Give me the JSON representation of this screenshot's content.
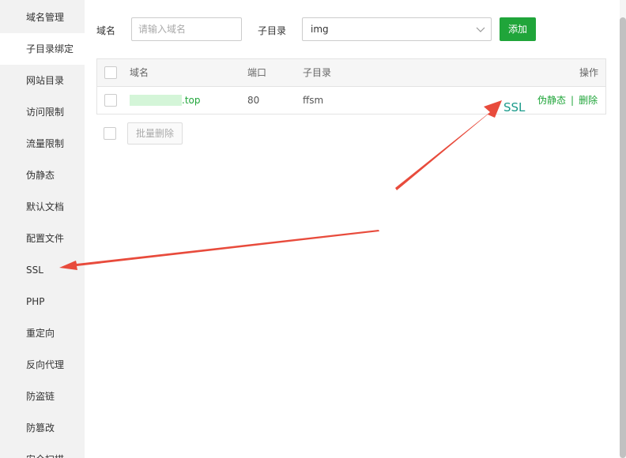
{
  "sidebar": {
    "items": [
      {
        "label": "域名管理"
      },
      {
        "label": "子目录绑定"
      },
      {
        "label": "网站目录"
      },
      {
        "label": "访问限制"
      },
      {
        "label": "流量限制"
      },
      {
        "label": "伪静态"
      },
      {
        "label": "默认文档"
      },
      {
        "label": "配置文件"
      },
      {
        "label": "SSL"
      },
      {
        "label": "PHP"
      },
      {
        "label": "重定向"
      },
      {
        "label": "反向代理"
      },
      {
        "label": "防盗链"
      },
      {
        "label": "防篡改"
      },
      {
        "label": "安全扫描"
      }
    ],
    "active_index": 1
  },
  "form": {
    "domain_label": "域名",
    "domain_placeholder": "请输入域名",
    "subdir_label": "子目录",
    "subdir_value": "img",
    "add_button": "添加"
  },
  "table": {
    "columns": [
      "域名",
      "端口",
      "子目录",
      "操作"
    ],
    "rows": [
      {
        "domain_suffix": ".top",
        "port": "80",
        "subdir": "ffsm",
        "actions": [
          "伪静态",
          "删除"
        ]
      }
    ]
  },
  "batch_delete": "批量删除",
  "annotation": {
    "label": "SSL",
    "arrow_color": "#e84b3c",
    "text_color": "#1a9a8a"
  }
}
